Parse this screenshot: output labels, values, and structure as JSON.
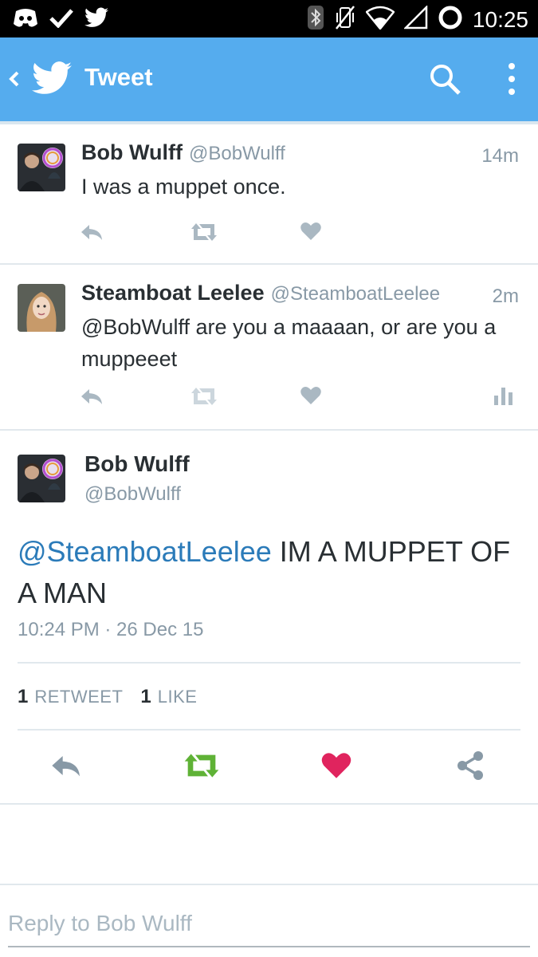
{
  "status_bar": {
    "time": "10:25",
    "left_icons": [
      "discord-icon",
      "check-icon",
      "twitter-icon"
    ],
    "right_icons": [
      "bluetooth-icon",
      "vibrate-off-icon",
      "wifi-icon",
      "signal-icon",
      "battery-ring-icon"
    ]
  },
  "app_bar": {
    "title": "Tweet",
    "icons": [
      "back-icon",
      "twitter-bird-icon",
      "search-icon",
      "more-vert-icon"
    ],
    "color": "#55acee"
  },
  "tweets": [
    {
      "name": "Bob Wulff",
      "handle": "@BobWulff",
      "time": "14m",
      "text": "I was a muppet once.",
      "actions": [
        "reply-icon",
        "retweet-icon",
        "like-icon"
      ]
    },
    {
      "name": "Steamboat Leelee",
      "handle": "@SteamboatLeelee",
      "time": "2m",
      "text": "@BobWulff are you a maaaan, or are you a muppeeet",
      "actions": [
        "reply-icon",
        "retweet-icon",
        "like-icon",
        "analytics-icon"
      ]
    }
  ],
  "main_tweet": {
    "name": "Bob Wulff",
    "handle": "@BobWulff",
    "mention": "@SteamboatLeelee",
    "text": " IM A MUPPET OF A MAN",
    "timestamp": "10:24 PM · 26 Dec 15",
    "retweets_count": "1",
    "retweets_label": "RETWEET",
    "likes_count": "1",
    "likes_label": "LIKE",
    "actions": [
      "reply-icon",
      "retweet-icon",
      "heart-icon",
      "share-icon"
    ],
    "colors": {
      "retweet": "#5fb236",
      "like": "#e0245e",
      "mention": "#2b7bb9"
    }
  },
  "reply": {
    "placeholder": "Reply to Bob Wulff"
  }
}
